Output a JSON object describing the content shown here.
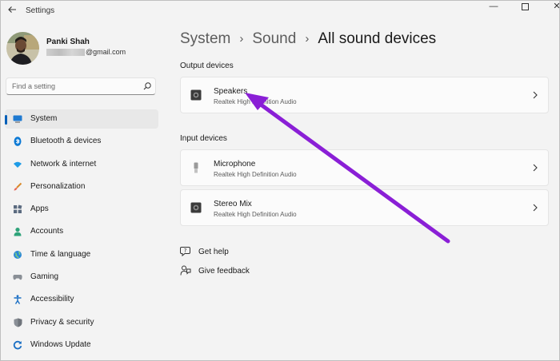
{
  "window": {
    "title": "Settings"
  },
  "titlebar": {
    "back_icon": "back-arrow-icon",
    "minimize_glyph": "—",
    "close_glyph": "✕"
  },
  "profile": {
    "name": "Panki Shah",
    "email_visible": "@gmail.com"
  },
  "search": {
    "placeholder": "Find a setting",
    "icon": "search-icon"
  },
  "sidebar": {
    "items": [
      {
        "label": "System",
        "icon": "system-icon",
        "active": true
      },
      {
        "label": "Bluetooth & devices",
        "icon": "bluetooth-icon"
      },
      {
        "label": "Network & internet",
        "icon": "wifi-icon"
      },
      {
        "label": "Personalization",
        "icon": "brush-icon"
      },
      {
        "label": "Apps",
        "icon": "apps-icon"
      },
      {
        "label": "Accounts",
        "icon": "accounts-icon"
      },
      {
        "label": "Time & language",
        "icon": "globe-icon"
      },
      {
        "label": "Gaming",
        "icon": "gamepad-icon"
      },
      {
        "label": "Accessibility",
        "icon": "accessibility-icon"
      },
      {
        "label": "Privacy & security",
        "icon": "shield-icon"
      },
      {
        "label": "Windows Update",
        "icon": "update-icon"
      }
    ]
  },
  "breadcrumb": {
    "items": [
      "System",
      "Sound",
      "All sound devices"
    ],
    "separator": "›"
  },
  "output": {
    "title": "Output devices",
    "devices": [
      {
        "name": "Speakers",
        "driver": "Realtek High Definition Audio",
        "icon": "speaker-icon"
      }
    ]
  },
  "input": {
    "title": "Input devices",
    "devices": [
      {
        "name": "Microphone",
        "driver": "Realtek High Definition Audio",
        "icon": "microphone-icon"
      },
      {
        "name": "Stereo Mix",
        "driver": "Realtek High Definition Audio",
        "icon": "speaker-icon"
      }
    ]
  },
  "help": {
    "get_help": "Get help",
    "give_feedback": "Give feedback"
  },
  "colors": {
    "accent": "#005fb8",
    "annotation_arrow": "#8a1fd6",
    "background": "#f3f3f3",
    "card": "#fbfbfb"
  }
}
